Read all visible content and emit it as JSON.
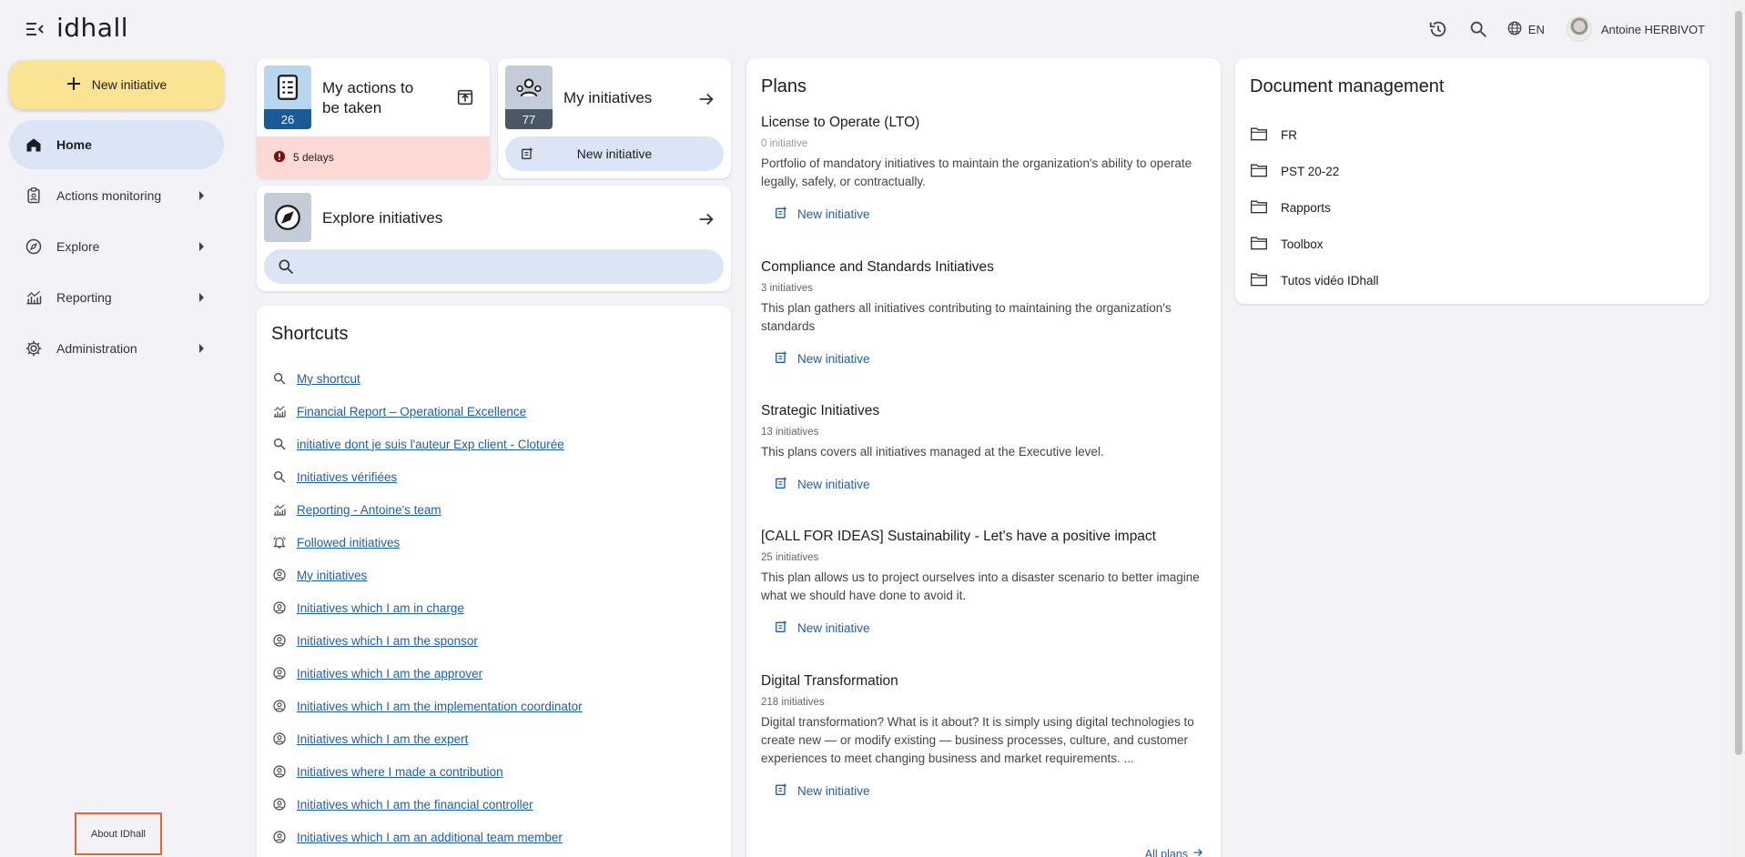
{
  "app": {
    "logo": "idhall"
  },
  "header": {
    "lang": "EN",
    "user_name": "Antoine HERBIVOT"
  },
  "sidebar": {
    "new_initiative": "New initiative",
    "items": [
      {
        "label": "Home",
        "icon": "home-icon",
        "active": true
      },
      {
        "label": "Actions monitoring",
        "icon": "clipboard-icon"
      },
      {
        "label": "Explore",
        "icon": "compass-icon"
      },
      {
        "label": "Reporting",
        "icon": "chart-icon"
      },
      {
        "label": "Administration",
        "icon": "gear-icon"
      }
    ],
    "about": "About IDhall"
  },
  "actions_card": {
    "title": "My actions to be taken",
    "count": "26",
    "delays": "5 delays",
    "count_color": "#1b5a96"
  },
  "my_initiatives_card": {
    "title": "My initiatives",
    "count": "77",
    "button": "New initiative",
    "count_color": "#4a5866"
  },
  "explore_card": {
    "title": "Explore initiatives",
    "search_placeholder": ""
  },
  "shortcuts": {
    "title": "Shortcuts",
    "items": [
      {
        "icon": "search-icon",
        "label": "My shortcut"
      },
      {
        "icon": "chart-icon",
        "label": "Financial Report – Operational Excellence"
      },
      {
        "icon": "search-icon",
        "label": "initiative dont je suis l'auteur Exp client - Cloturée"
      },
      {
        "icon": "search-icon",
        "label": "Initiatives vérifiées"
      },
      {
        "icon": "chart-icon",
        "label": "Reporting - Antoine's team"
      },
      {
        "icon": "bell-icon",
        "label": "Followed initiatives"
      },
      {
        "icon": "user-circle-icon",
        "label": "My initiatives"
      },
      {
        "icon": "user-circle-icon",
        "label": "Initiatives which I am in charge"
      },
      {
        "icon": "user-circle-icon",
        "label": "Initiatives which I am the sponsor"
      },
      {
        "icon": "user-circle-icon",
        "label": "Initiatives which I am the approver"
      },
      {
        "icon": "user-circle-icon",
        "label": "Initiatives which I am the implementation coordinator"
      },
      {
        "icon": "user-circle-icon",
        "label": "Initiatives which I am the expert"
      },
      {
        "icon": "user-circle-icon",
        "label": "Initiatives where I made a contribution"
      },
      {
        "icon": "user-circle-icon",
        "label": "Initiatives which I am the financial controller"
      },
      {
        "icon": "user-circle-icon",
        "label": "Initiatives which I am an additional team member"
      }
    ]
  },
  "plans": {
    "title": "Plans",
    "new_label": "New initiative",
    "all_plans": "All plans",
    "items": [
      {
        "name": "License to Operate (LTO)",
        "count": "0 initiative",
        "desc": "Portfolio of mandatory initiatives to maintain the organization's ability to operate legally, safely, or contractually."
      },
      {
        "name": "Compliance and Standards Initiatives",
        "count": "3 initiatives",
        "desc": "This plan gathers all initiatives contributing to maintaining the organization's standards"
      },
      {
        "name": "Strategic Initiatives",
        "count": "13 initiatives",
        "desc": "This plans covers all initiatives managed at the Executive level."
      },
      {
        "name": "[CALL FOR IDEAS] Sustainability - Let's have a positive impact",
        "count": "25 initiatives",
        "desc": "This plan allows us to project ourselves into a disaster scenario to better imagine what we should have done to avoid it."
      },
      {
        "name": "Digital Transformation",
        "count": "218 initiatives",
        "desc": "Digital transformation? What is it about? It is simply using digital technologies to create new — or modify existing — business processes, culture, and customer experiences to meet changing business and market requirements. ..."
      }
    ]
  },
  "documents": {
    "title": "Document management",
    "folders": [
      "FR",
      "PST 20-22",
      "Rapports",
      "Toolbox",
      "Tutos vidéo IDhall"
    ]
  }
}
